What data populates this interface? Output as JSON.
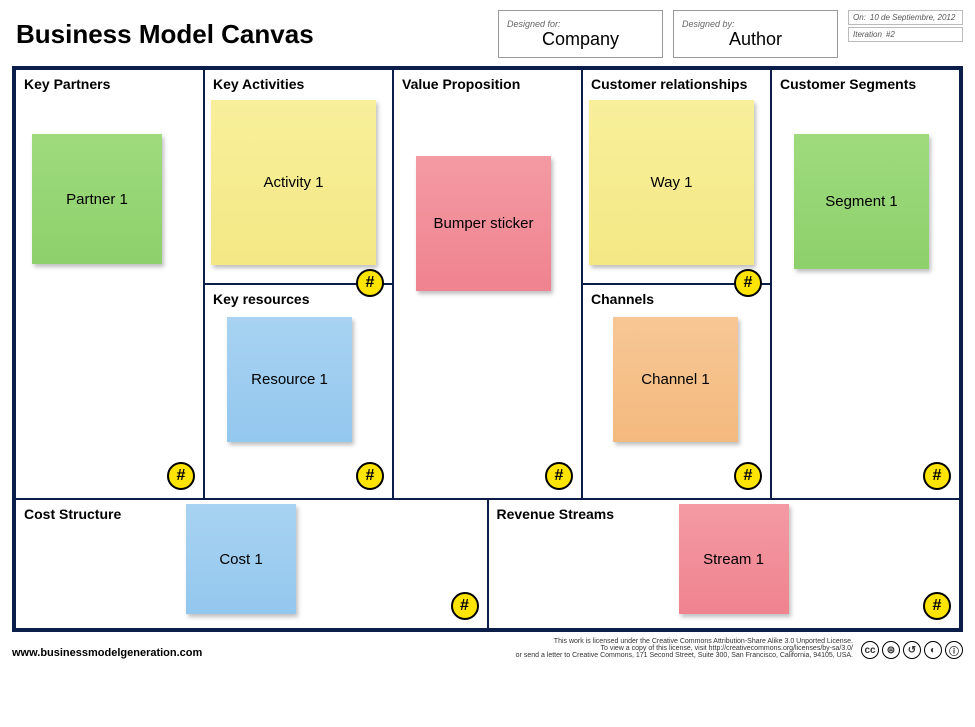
{
  "title": "Business Model Canvas",
  "meta": {
    "designed_for_label": "Designed for:",
    "designed_for": "Company",
    "designed_by_label": "Designed by:",
    "designed_by": "Author",
    "on_label": "On:",
    "on_value": "10 de Septiembre, 2012",
    "iteration_label": "Iteration",
    "iteration_value": "#2"
  },
  "blocks": {
    "key_partners": {
      "heading": "Key Partners",
      "note": "Partner 1"
    },
    "key_activities": {
      "heading": "Key Activities",
      "note": "Activity 1"
    },
    "key_resources": {
      "heading": "Key resources",
      "note": "Resource 1"
    },
    "value_proposition": {
      "heading": "Value Proposition",
      "note": "Bumper sticker"
    },
    "customer_relationships": {
      "heading": "Customer relationships",
      "note": "Way 1"
    },
    "channels": {
      "heading": "Channels",
      "note": "Channel 1"
    },
    "customer_segments": {
      "heading": "Customer Segments",
      "note": "Segment 1"
    },
    "cost_structure": {
      "heading": "Cost Structure",
      "note": "Cost 1"
    },
    "revenue_streams": {
      "heading": "Revenue Streams",
      "note": "Stream 1"
    }
  },
  "hash": "#",
  "footer": {
    "url": "www.businessmodelgeneration.com",
    "license1": "This work is licensed under the Creative Commons Attribution-Share Alike 3.0 Unported License.",
    "license2": "To view a copy of this license, visit http://creativecommons.org/licenses/by-sa/3.0/",
    "license3": "or send a letter to Creative Commons, 171 Second Street, Suite 300, San Francisco, California, 94105, USA.",
    "cc": [
      "cc",
      "⊜",
      "↺",
      "◐",
      "ⓘ"
    ]
  }
}
